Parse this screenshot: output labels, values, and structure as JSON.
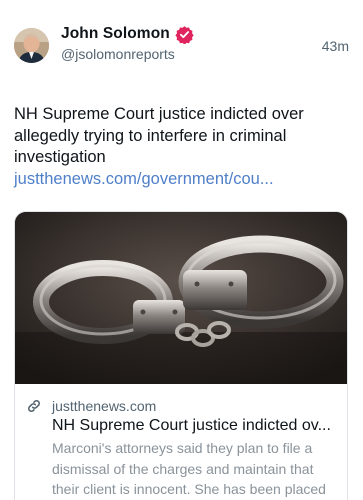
{
  "author": {
    "display_name": "John Solomon",
    "handle": "@jsolomonreports",
    "verified_icon": "verified-badge-icon",
    "verified_color": "#e0245e"
  },
  "post": {
    "timestamp": "43m",
    "text": "NH Supreme Court justice indicted over allegedly trying to interfere in criminal investigation ",
    "link_text": "justthenews.com/government/cou...",
    "link_color": "#4f7fc9"
  },
  "card": {
    "image_subject": "handcuffs",
    "domain_icon": "link-icon",
    "domain": "justthenews.com",
    "title": "NH Supreme Court justice indicted ov...",
    "description": "Marconi's attorneys said they plan to file a dismissal of the charges and maintain that their client is innocent. She has been placed on administrative leave since July."
  }
}
